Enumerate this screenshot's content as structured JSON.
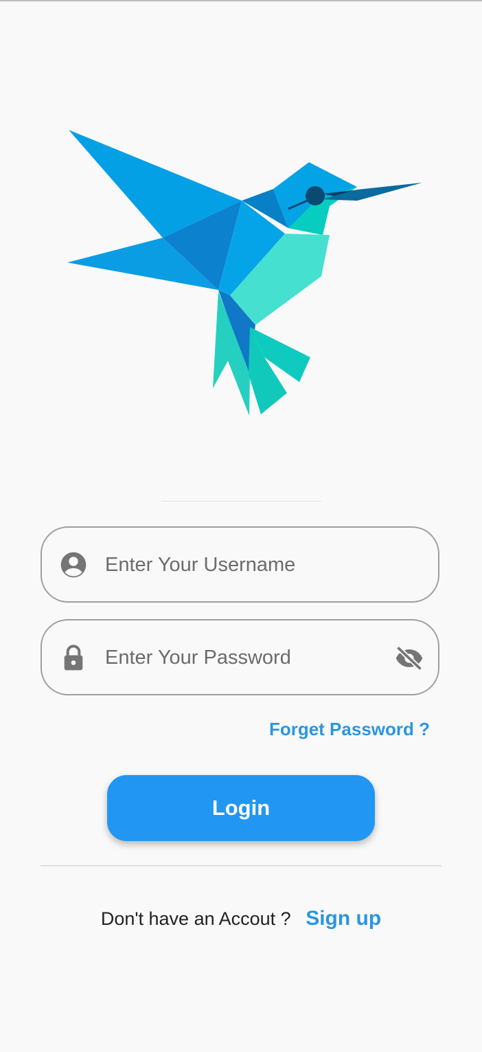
{
  "login_form": {
    "username_placeholder": "Enter Your Username",
    "password_placeholder": "Enter Your Password",
    "forget_password_label": "Forget Password ?",
    "login_label": "Login"
  },
  "signup": {
    "prompt": "Don't have an Accout ?",
    "link_label": "Sign up"
  },
  "icons": {
    "username": "account-circle-icon",
    "password": "lock-icon",
    "visibility": "visibility-off-icon"
  },
  "colors": {
    "accent": "#2196f3",
    "link": "#2a96e0",
    "background": "#f9f9f9",
    "field_border": "#9e9e9e",
    "icon_gray": "#757575"
  }
}
